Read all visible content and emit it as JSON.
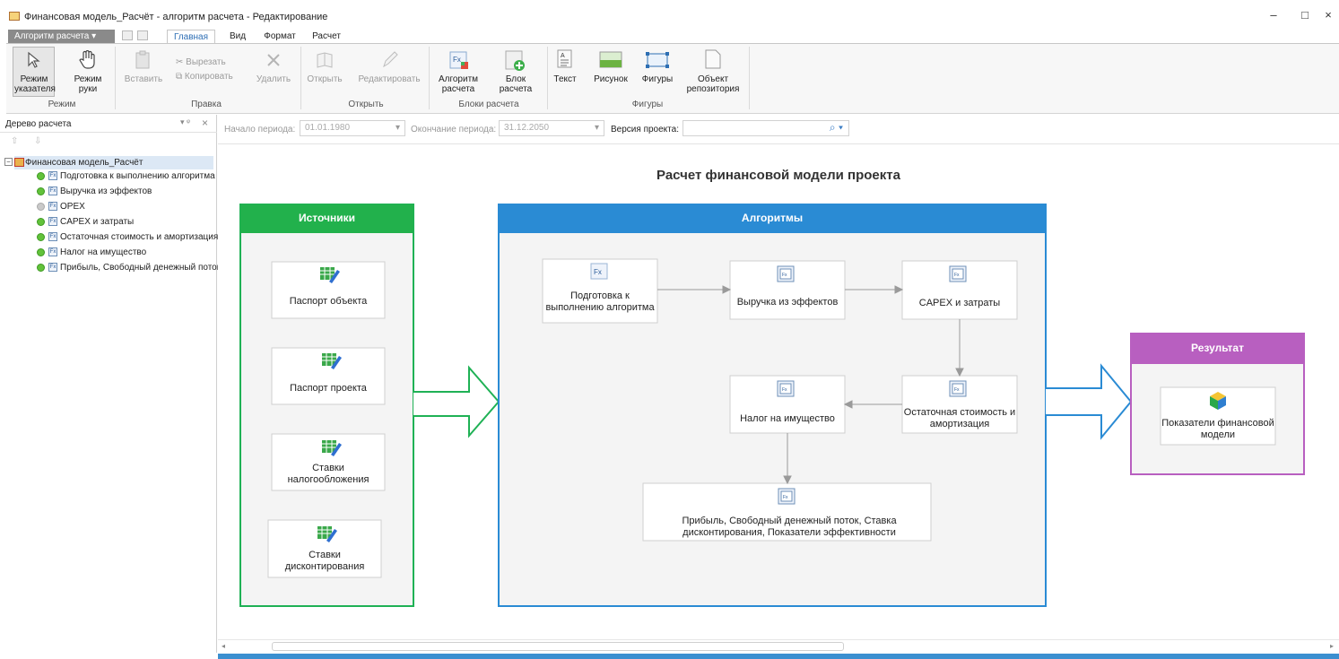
{
  "window": {
    "title": "Финансовая модель_Расчёт - алгоритм расчета - Редактирование",
    "minimize": "–",
    "maximize": "□",
    "close": "×"
  },
  "ribbon_tabs": {
    "app_menu": "Алгоритм расчета",
    "home": "Главная",
    "view": "Вид",
    "format": "Формат",
    "calc": "Расчет"
  },
  "ribbon": {
    "mode": {
      "pointer": "Режим указателя",
      "hand": "Режим руки",
      "group": "Режим"
    },
    "edit": {
      "paste": "Вставить",
      "cut": "Вырезать",
      "copy": "Копировать",
      "delete": "Удалить",
      "group": "Правка"
    },
    "open": {
      "open": "Открыть",
      "edit": "Редактировать",
      "group": "Открыть"
    },
    "blocks": {
      "algorithm": "Алгоритм расчета",
      "block": "Блок расчета",
      "group": "Блоки расчета"
    },
    "figures": {
      "text": "Текст",
      "picture": "Рисунок",
      "shapes": "Фигуры",
      "repo": "Объект репозитория",
      "group": "Фигуры"
    }
  },
  "panel": {
    "title": "Дерево расчета",
    "pin": "▾ ᵠ",
    "close": "×"
  },
  "tree": {
    "root": "Финансовая модель_Расчёт",
    "items": [
      {
        "label": "Подготовка к выполнению алгоритма",
        "status": "green"
      },
      {
        "label": "Выручка из эффектов",
        "status": "green"
      },
      {
        "label": "OPEX",
        "status": "gray"
      },
      {
        "label": "CAPEX и затраты",
        "status": "green"
      },
      {
        "label": "Остаточная стоимость и амортизация",
        "status": "green"
      },
      {
        "label": "Налог на имущество",
        "status": "green"
      },
      {
        "label": "Прибыль, Свободный денежный поток",
        "status": "green"
      }
    ]
  },
  "filters": {
    "start_label": "Начало периода:",
    "start_value": "01.01.1980",
    "end_label": "Окончание периода:",
    "end_value": "31.12.2050",
    "version_label": "Версия проекта:",
    "version_value": ""
  },
  "diagram": {
    "title": "Расчет финансовой модели проекта",
    "sources": {
      "header": "Источники",
      "items": [
        "Паспорт объекта",
        "Паспорт проекта",
        "Ставки налогообложения",
        "Ставки дисконтирования"
      ]
    },
    "algorithms": {
      "header": "Алгоритмы",
      "nodes": {
        "prep": "Подготовка к выполнению алгоритма",
        "revenue": "Выручка из эффектов",
        "capex": "CAPEX и затраты",
        "residual": "Остаточная стоимость и амортизация",
        "tax": "Налог на имущество",
        "profit": "Прибыль, Свободный денежный поток, Ставка дисконтирования, Показатели эффективности"
      }
    },
    "result": {
      "header": "Результат",
      "item": "Показатели финансовой модели"
    }
  },
  "colors": {
    "green": "#1db954",
    "blue": "#2a8bd4",
    "purple": "#b85fc0",
    "node_bg": "#f2f2f2"
  }
}
